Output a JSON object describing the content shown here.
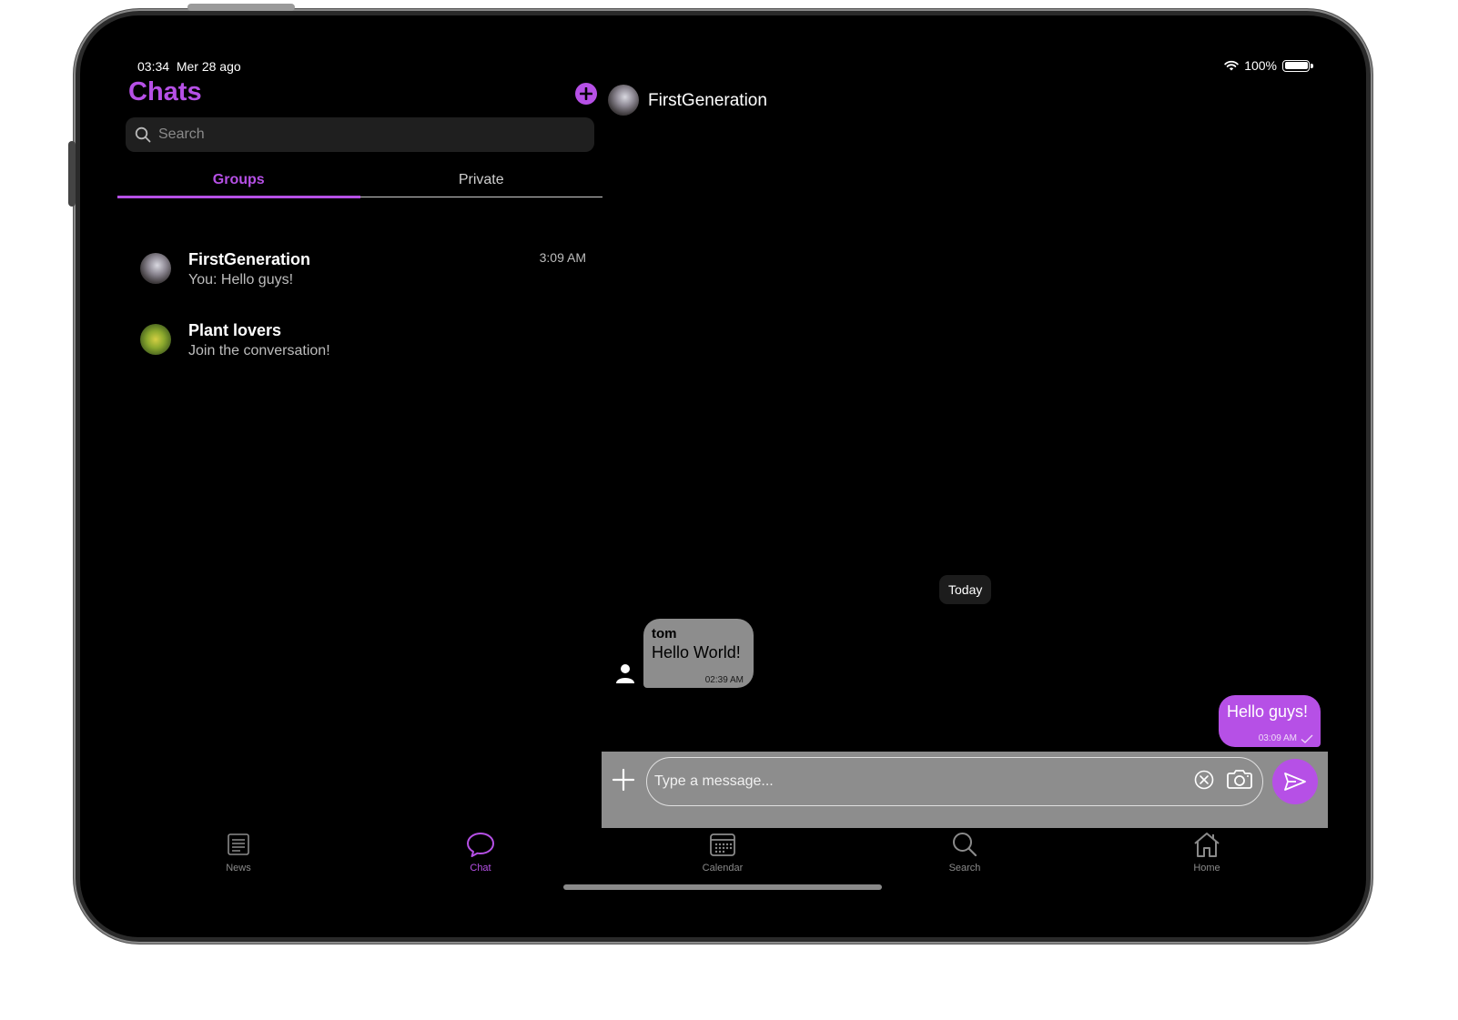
{
  "status_bar": {
    "time": "03:34",
    "date": "Mer 28 ago",
    "battery": "100%"
  },
  "sidebar": {
    "title": "Chats",
    "search_placeholder": "Search",
    "tabs": [
      {
        "label": "Groups",
        "active": true
      },
      {
        "label": "Private",
        "active": false
      }
    ],
    "chats": [
      {
        "name": "FirstGeneration",
        "preview": "You: Hello guys!",
        "time": "3:09 AM"
      },
      {
        "name": "Plant lovers",
        "preview": "Join the conversation!",
        "time": ""
      }
    ]
  },
  "conversation": {
    "title": "FirstGeneration",
    "date_divider": "Today",
    "messages": [
      {
        "sender": "tom",
        "text": "Hello World!",
        "time": "02:39 AM",
        "outgoing": false
      },
      {
        "sender": "",
        "text": "Hello guys!",
        "time": "03:09 AM",
        "outgoing": true,
        "status": "sent"
      }
    ],
    "composer_placeholder": "Type a message..."
  },
  "tab_bar": [
    {
      "label": "News",
      "icon": "news-icon",
      "active": false
    },
    {
      "label": "Chat",
      "icon": "chat-bubble-icon",
      "active": true
    },
    {
      "label": "Calendar",
      "icon": "calendar-icon",
      "active": false
    },
    {
      "label": "Search",
      "icon": "search-icon",
      "active": false
    },
    {
      "label": "Home",
      "icon": "home-icon",
      "active": false
    }
  ],
  "colors": {
    "accent": "#b650e6",
    "background": "#000000",
    "incoming_bubble": "#8d8d8d",
    "composer": "#8d8d8d"
  }
}
